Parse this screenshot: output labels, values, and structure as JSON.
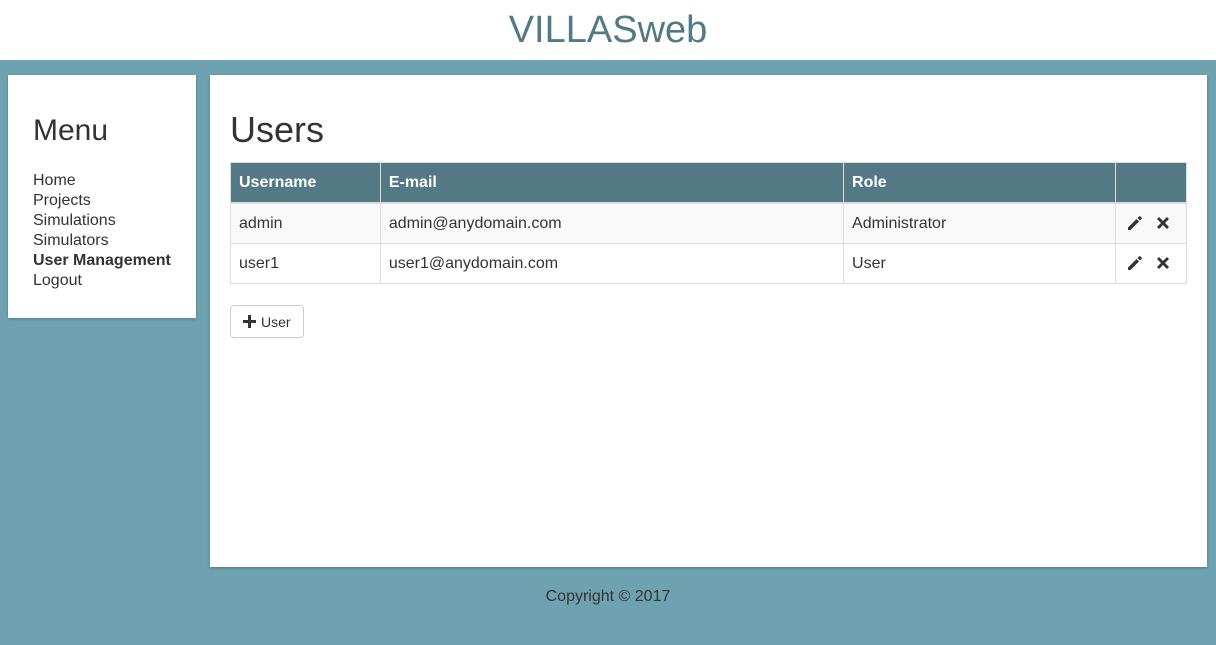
{
  "header": {
    "title": "VILLASweb"
  },
  "menu": {
    "title": "Menu",
    "items": [
      {
        "label": "Home"
      },
      {
        "label": "Projects"
      },
      {
        "label": "Simulations"
      },
      {
        "label": "Simulators"
      },
      {
        "label": "User Management",
        "active": true
      },
      {
        "label": "Logout"
      }
    ]
  },
  "main": {
    "title": "Users",
    "table": {
      "columns": [
        "Username",
        "E-mail",
        "Role",
        ""
      ],
      "rows": [
        {
          "username": "admin",
          "email": "admin@anydomain.com",
          "role": "Administrator"
        },
        {
          "username": "user1",
          "email": "user1@anydomain.com",
          "role": "User"
        }
      ]
    },
    "add_button_label": "User"
  },
  "footer": {
    "text": "Copyright © 2017"
  },
  "colors": {
    "background": "#6ea2b0",
    "accent": "#527984",
    "row_stripe": "#f9f9f9"
  },
  "icons": {
    "edit": "pencil-icon",
    "delete": "close-icon",
    "add": "plus-icon"
  }
}
